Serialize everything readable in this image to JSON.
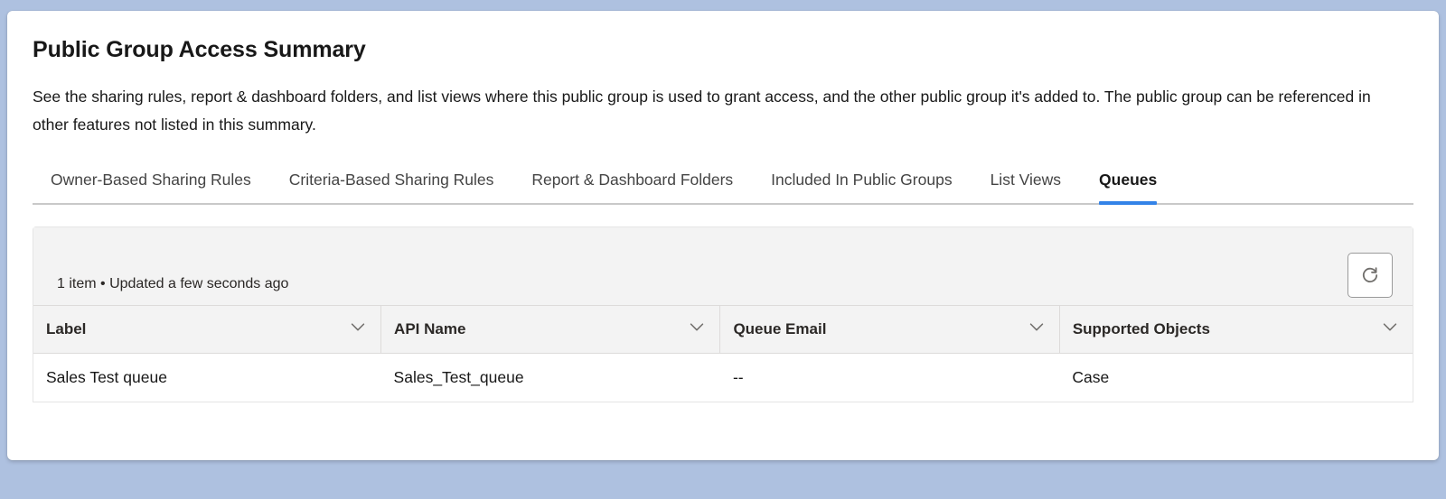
{
  "page": {
    "title": "Public Group Access Summary",
    "description": "See the sharing rules, report & dashboard folders, and list views where this public group is used to grant access, and the other public group it's added to. The public group can be referenced in other features not listed in this summary."
  },
  "tabs": [
    {
      "label": "Owner-Based Sharing Rules",
      "active": false
    },
    {
      "label": "Criteria-Based Sharing Rules",
      "active": false
    },
    {
      "label": "Report & Dashboard Folders",
      "active": false
    },
    {
      "label": "Included In Public Groups",
      "active": false
    },
    {
      "label": "List Views",
      "active": false
    },
    {
      "label": "Queues",
      "active": true
    }
  ],
  "list": {
    "status_text": "1 item • Updated a few seconds ago",
    "refresh_icon": "refresh-icon",
    "columns": [
      {
        "label": "Label",
        "sort_icon": "chevron-down-icon"
      },
      {
        "label": "API Name",
        "sort_icon": "chevron-down-icon"
      },
      {
        "label": "Queue Email",
        "sort_icon": "chevron-down-icon"
      },
      {
        "label": "Supported Objects",
        "sort_icon": "chevron-down-icon"
      }
    ],
    "rows": [
      {
        "label": "Sales Test queue",
        "api_name": "Sales_Test_queue",
        "queue_email": "--",
        "supported_objects": "Case"
      }
    ]
  },
  "colors": {
    "page_background": "#aec1e0",
    "card_background": "#ffffff",
    "active_tab_underline": "#3383e8",
    "header_row_background": "#f3f3f3",
    "text_primary": "#181818",
    "text_secondary": "#444444",
    "border": "#dddbda"
  }
}
